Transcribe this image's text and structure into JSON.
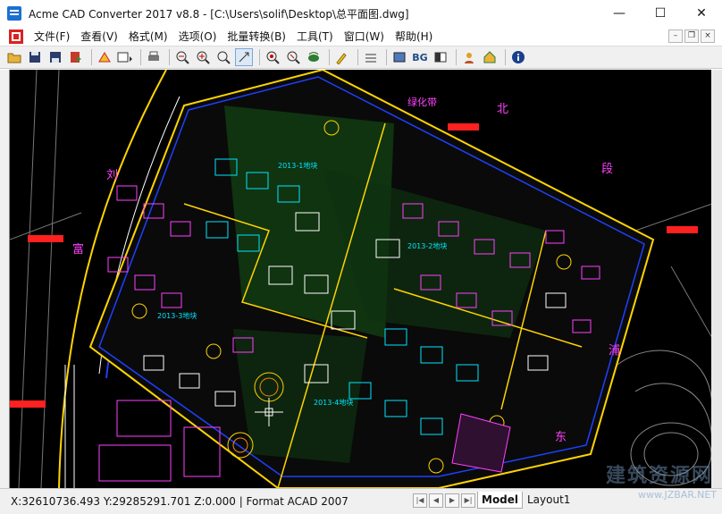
{
  "window": {
    "title": "Acme CAD Converter 2017 v8.8 - [C:\\Users\\solif\\Desktop\\总平面图.dwg]",
    "buttons": {
      "minimize": "—",
      "maximize": "☐",
      "close": "✕"
    }
  },
  "menu": {
    "items": [
      "文件(F)",
      "查看(V)",
      "格式(M)",
      "选项(O)",
      "批量转换(B)",
      "工具(T)",
      "窗口(W)",
      "帮助(H)"
    ],
    "mdi": {
      "minimize": "–",
      "restore": "❐",
      "close": "×"
    }
  },
  "toolbar": {
    "bg_label": "BG"
  },
  "drawing": {
    "labels": [
      "绿化带",
      "北",
      "段",
      "浦",
      "东",
      "刘",
      "富",
      "2013-1地块",
      "2013-2地块",
      "2013-3地块",
      "2013-4地块"
    ]
  },
  "status": {
    "coords": "X:32610736.493 Y:29285291.701 Z:0.000 | Format ACAD 2007",
    "tabs": [
      "Model",
      "Layout1"
    ]
  },
  "watermark": {
    "text": "建筑资源网",
    "url": "www.JZBAR.NET"
  }
}
